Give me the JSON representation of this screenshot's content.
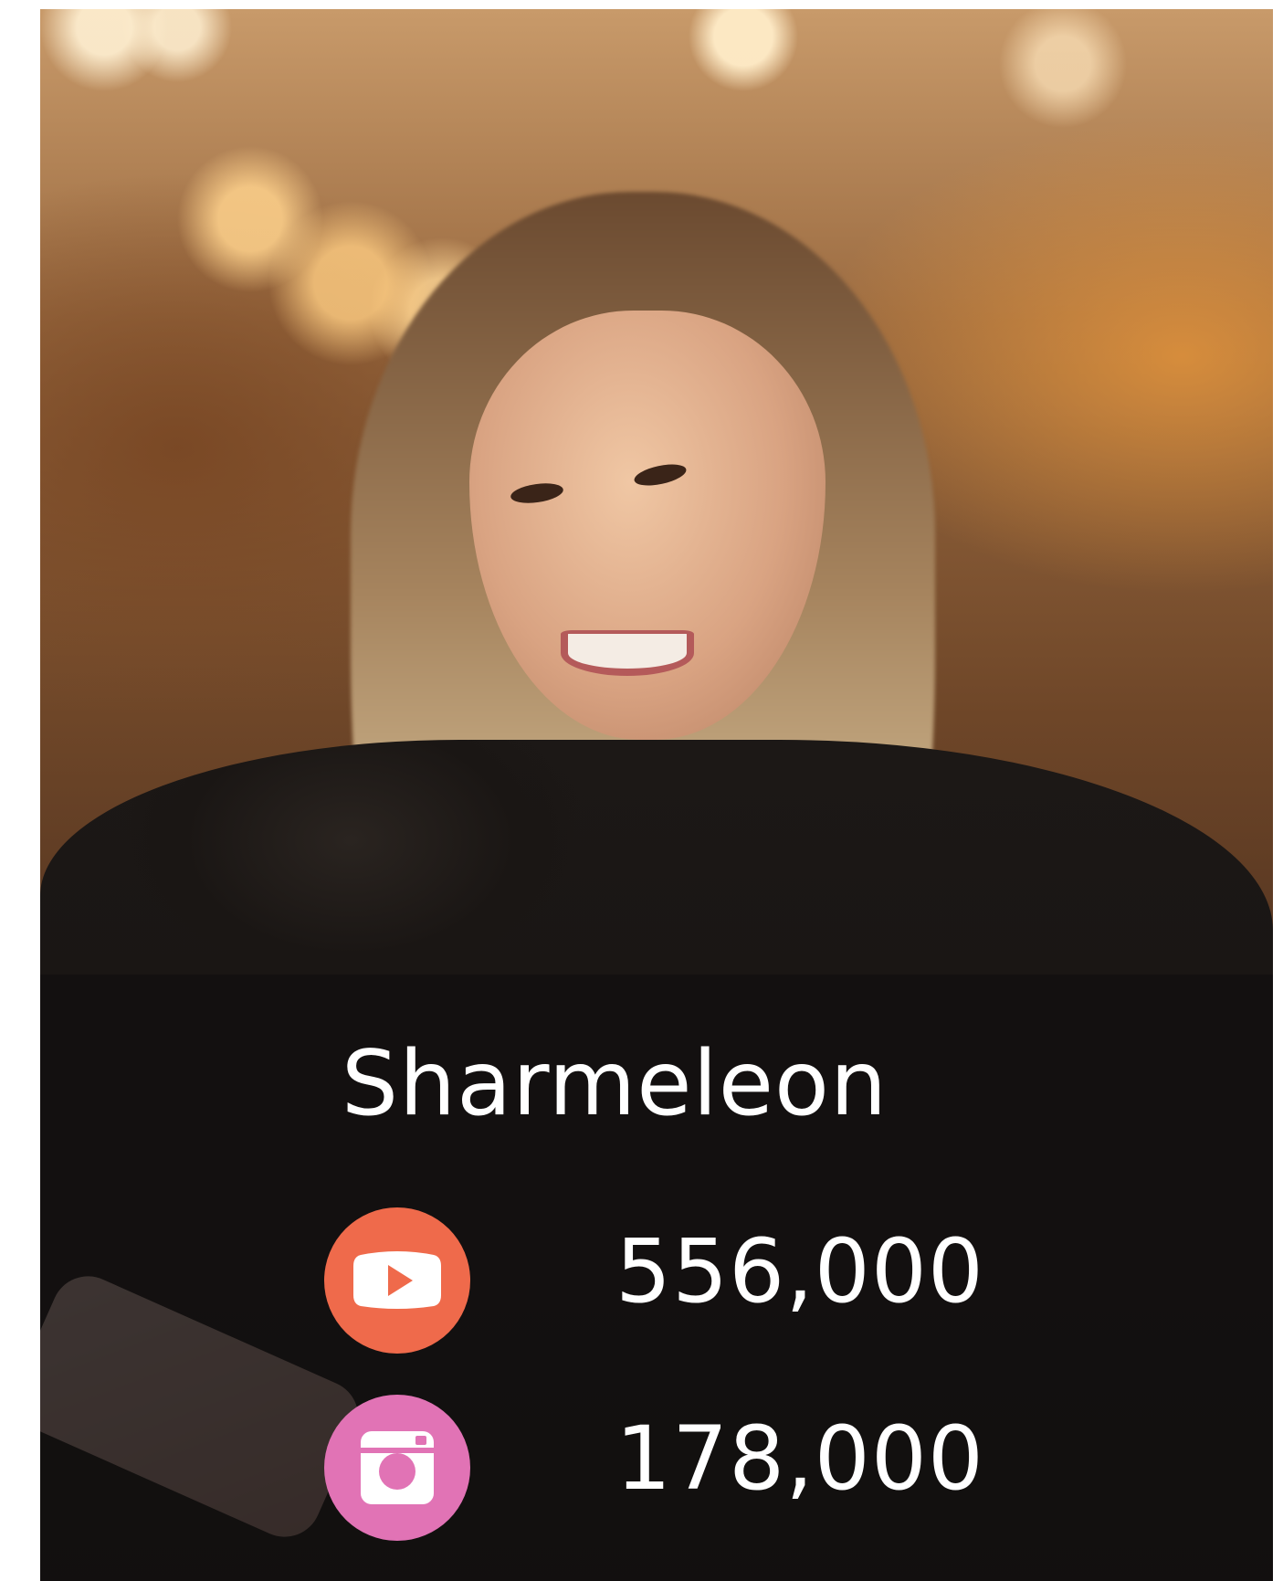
{
  "profile": {
    "name": "Sharmeleon"
  },
  "stats": [
    {
      "platform_icon": "youtube-icon",
      "count": "556,000",
      "color": "#ef6a4b"
    },
    {
      "platform_icon": "instagram-icon",
      "count": "178,000",
      "color": "#e173b5"
    }
  ]
}
